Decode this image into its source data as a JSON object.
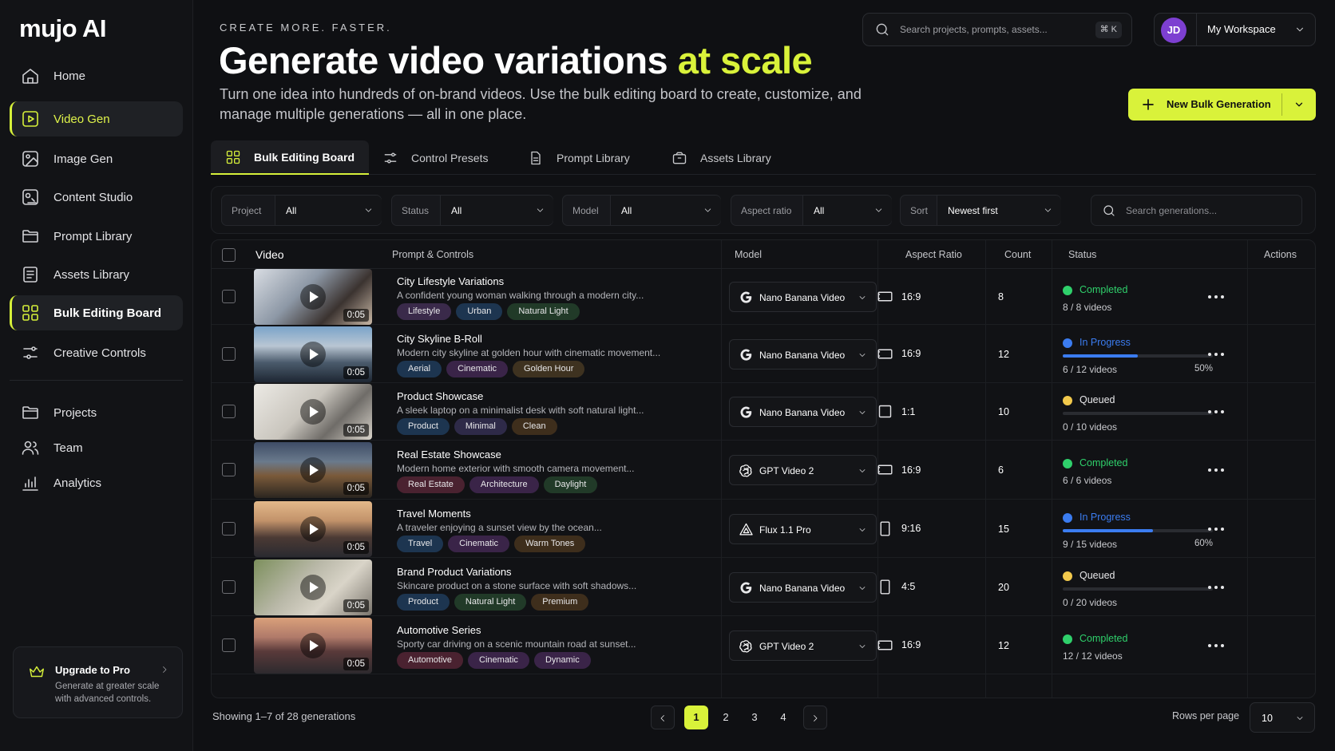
{
  "app": {
    "logo": "mujo AI"
  },
  "sidebar": {
    "items": [
      {
        "label": "Home",
        "icon": "home-icon"
      },
      {
        "label": "Video Gen",
        "icon": "video-icon"
      },
      {
        "label": "Image Gen",
        "icon": "image-icon"
      },
      {
        "label": "Content Studio",
        "icon": "studio-icon"
      },
      {
        "label": "Prompt Library",
        "icon": "folder-icon"
      },
      {
        "label": "Assets Library",
        "icon": "assets-icon"
      },
      {
        "label": "Bulk Editing Board",
        "icon": "grid-icon"
      },
      {
        "label": "Creative Controls",
        "icon": "sliders-icon"
      }
    ],
    "secondary": [
      {
        "label": "Projects",
        "icon": "folder-icon"
      },
      {
        "label": "Team",
        "icon": "team-icon"
      },
      {
        "label": "Analytics",
        "icon": "analytics-icon"
      }
    ],
    "upgrade": {
      "title": "Upgrade to Pro",
      "desc": "Generate at greater scale with advanced controls."
    }
  },
  "header": {
    "eyebrow": "CREATE MORE. FASTER.",
    "title_main": "Generate video variations",
    "title_accent": "at scale",
    "subtitle": "Turn one idea into hundreds of on-brand videos. Use the bulk editing board to create, customize, and manage multiple generations — all in one place.",
    "search_placeholder": "Search projects, prompts, assets...",
    "search_shortcut": "⌘ K",
    "avatar_initials": "JD",
    "workspace": "My Workspace",
    "new_button": "New Bulk Generation"
  },
  "tabs": [
    {
      "label": "Bulk Editing Board"
    },
    {
      "label": "Control Presets"
    },
    {
      "label": "Prompt Library"
    },
    {
      "label": "Assets Library"
    }
  ],
  "filters": {
    "project": {
      "label": "Project",
      "value": "All"
    },
    "status": {
      "label": "Status",
      "value": "All"
    },
    "model": {
      "label": "Model",
      "value": "All"
    },
    "aspect": {
      "label": "Aspect ratio",
      "value": "All"
    },
    "sort": {
      "label": "Sort",
      "value": "Newest first"
    },
    "search_placeholder": "Search generations..."
  },
  "table": {
    "headers": {
      "video": "Video",
      "prompt": "Prompt & Controls",
      "model": "Model",
      "aspect": "Aspect Ratio",
      "count": "Count",
      "status": "Status",
      "actions": "Actions"
    },
    "rows": [
      {
        "title": "City Lifestyle Variations",
        "desc": "A confident young woman walking through a modern city...",
        "duration": "0:05",
        "tags": [
          "Lifestyle",
          "Urban",
          "Natural Light"
        ],
        "model": "Nano Banana Video",
        "model_icon": "google-g-icon",
        "aspect": "16:9",
        "aspect_icon": "landscape-icon",
        "count": "8",
        "status": "Completed",
        "status_color": "#2fd06b",
        "progress_text": "8 / 8 videos"
      },
      {
        "title": "City Skyline B-Roll",
        "desc": "Modern city skyline at golden hour with cinematic movement...",
        "duration": "0:05",
        "tags": [
          "Aerial",
          "Cinematic",
          "Golden Hour"
        ],
        "model": "Nano Banana Video",
        "model_icon": "google-g-icon",
        "aspect": "16:9",
        "aspect_icon": "landscape-icon",
        "count": "12",
        "status": "In Progress",
        "status_color": "#3b7cf0",
        "progress_text": "6 / 12 videos",
        "progress": 0.5,
        "percent": "50%"
      },
      {
        "title": "Product Showcase",
        "desc": "A sleek laptop on a minimalist desk with soft natural light...",
        "duration": "0:05",
        "tags": [
          "Product",
          "Minimal",
          "Clean"
        ],
        "model": "Nano Banana Video",
        "model_icon": "google-g-icon",
        "aspect": "1:1",
        "aspect_icon": "square-icon",
        "count": "10",
        "status": "Queued",
        "status_color": "#f2c94c",
        "progress_text": "0 / 10 videos",
        "progress": 0
      },
      {
        "title": "Real Estate Showcase",
        "desc": "Modern home exterior with smooth camera movement...",
        "duration": "0:05",
        "tags": [
          "Real Estate",
          "Architecture",
          "Daylight"
        ],
        "model": "GPT Video 2",
        "model_icon": "openai-icon",
        "aspect": "16:9",
        "aspect_icon": "landscape-icon",
        "count": "6",
        "status": "Completed",
        "status_color": "#2fd06b",
        "progress_text": "6 / 6 videos"
      },
      {
        "title": "Travel Moments",
        "desc": "A traveler enjoying a sunset view by the ocean...",
        "duration": "0:05",
        "tags": [
          "Travel",
          "Cinematic",
          "Warm Tones"
        ],
        "model": "Flux 1.1 Pro",
        "model_icon": "flux-triangle-icon",
        "aspect": "9:16",
        "aspect_icon": "portrait-icon",
        "count": "15",
        "status": "In Progress",
        "status_color": "#3b7cf0",
        "progress_text": "9 / 15 videos",
        "progress": 0.6,
        "percent": "60%"
      },
      {
        "title": "Brand Product Variations",
        "desc": "Skincare product on a stone surface with soft shadows...",
        "duration": "0:05",
        "tags": [
          "Product",
          "Natural Light",
          "Premium"
        ],
        "model": "Nano Banana Video",
        "model_icon": "google-g-icon",
        "aspect": "4:5",
        "aspect_icon": "portrait-icon",
        "count": "20",
        "status": "Queued",
        "status_color": "#f2c94c",
        "progress_text": "0 / 20 videos",
        "progress": 0
      },
      {
        "title": "Automotive Series",
        "desc": "Sporty car driving on a scenic mountain road at sunset...",
        "duration": "0:05",
        "tags": [
          "Automotive",
          "Cinematic",
          "Dynamic"
        ],
        "model": "GPT Video 2",
        "model_icon": "openai-icon",
        "aspect": "16:9",
        "aspect_icon": "landscape-icon",
        "count": "12",
        "status": "Completed",
        "status_color": "#2fd06b",
        "progress_text": "12 / 12 videos"
      }
    ]
  },
  "footer": {
    "showing": "Showing 1–7 of 28 generations",
    "pages": [
      "1",
      "2",
      "3",
      "4"
    ],
    "current_page": "1",
    "rows_per_page_label": "Rows per page",
    "rows_per_page": "10"
  }
}
